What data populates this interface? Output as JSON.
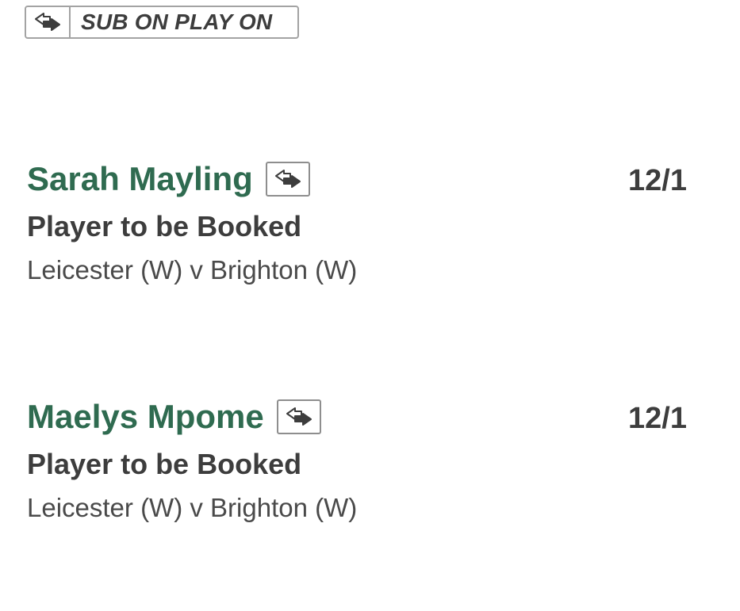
{
  "badge": {
    "icon": "substitution-arrows-icon",
    "label": "SUB ON PLAY ON"
  },
  "selections": [
    {
      "player": "Sarah Mayling",
      "icon": "substitution-arrows-icon",
      "odds": "12/1",
      "market": "Player to be Booked",
      "event": "Leicester (W) v Brighton (W)"
    },
    {
      "player": "Maelys Mpome",
      "icon": "substitution-arrows-icon",
      "odds": "12/1",
      "market": "Player to be Booked",
      "event": "Leicester (W) v Brighton (W)"
    }
  ],
  "colors": {
    "player_name": "#2f6b50",
    "text_dark": "#3d3d3d",
    "text_muted": "#4a4a4a",
    "border": "#a3a3a3"
  }
}
